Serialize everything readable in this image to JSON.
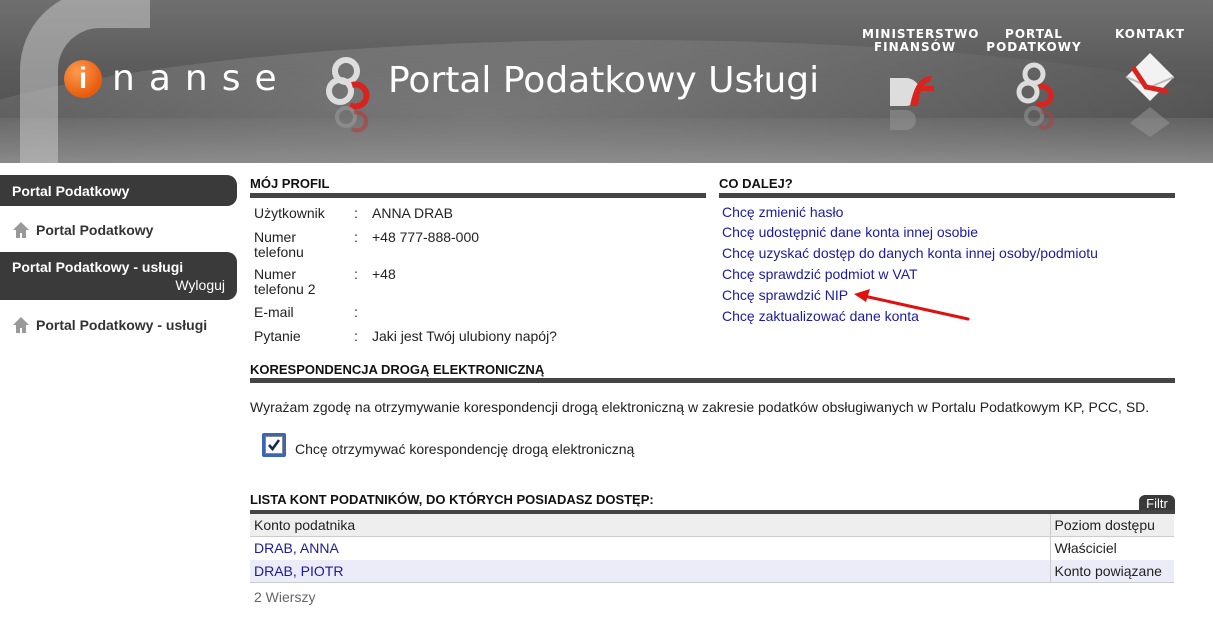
{
  "header": {
    "logo_letter": "i",
    "logo_text": "nanse",
    "portal_title": "Portal Podatkowy Usługi",
    "links": {
      "ministerstwo": "MINISTERSTWO\nFINANSÓW",
      "portal": "PORTAL\nPODATKOWY",
      "kontakt": "KONTAKT"
    }
  },
  "sidebar": {
    "section1_title": "Portal Podatkowy",
    "item1": "Portal Podatkowy",
    "section2_title": "Portal Podatkowy - usługi",
    "logout": "Wyloguj",
    "item2": "Portal Podatkowy - usługi"
  },
  "profile": {
    "title": "MÓJ PROFIL",
    "colon": ":",
    "rows": [
      {
        "key": "Użytkownik",
        "value": "ANNA DRAB"
      },
      {
        "key": "Numer\ntelefonu",
        "value": "+48 777-888-000"
      },
      {
        "key": "Numer\ntelefonu 2",
        "value": "+48"
      },
      {
        "key": "E-mail",
        "value": ""
      },
      {
        "key": "Pytanie",
        "value": "Jaki jest Twój ulubiony napój?"
      }
    ]
  },
  "next": {
    "title": "CO DALEJ?",
    "links": [
      "Chcę zmienić hasło",
      "Chcę udostępnić dane konta innej osobie",
      "Chcę uzyskać dostęp do danych konta innej osoby/podmiotu",
      "Chcę sprawdzić podmiot w VAT",
      "Chcę sprawdzić NIP",
      "Chcę zaktualizować dane konta"
    ]
  },
  "correspondence": {
    "title": "KORESPONDENCJA DROGĄ ELEKTRONICZNĄ",
    "consent_text": "Wyrażam zgodę na otrzymywanie korespondencji drogą elektroniczną w zakresie podatków obsługiwanych w Portalu Podatkowym KP, PCC, SD.",
    "checkbox_label": "Chcę otrzymywać korespondencję drogą elektroniczną",
    "checked": true
  },
  "accounts": {
    "title": "LISTA KONT PODATNIKÓW, DO KTÓRYCH POSIADASZ DOSTĘP:",
    "filter_label": "Filtr",
    "columns": [
      "Konto podatnika",
      "Poziom dostępu"
    ],
    "rows": [
      {
        "account": "DRAB, ANNA",
        "level": "Właściciel"
      },
      {
        "account": "DRAB, PIOTR",
        "level": "Konto powiązane"
      }
    ],
    "rows_count": "2 Wierszy"
  },
  "colors": {
    "header_bg": "#5a5a5a",
    "accent_orange": "#e85c0d",
    "link": "#1a1aa6",
    "arrow": "#e01010"
  }
}
